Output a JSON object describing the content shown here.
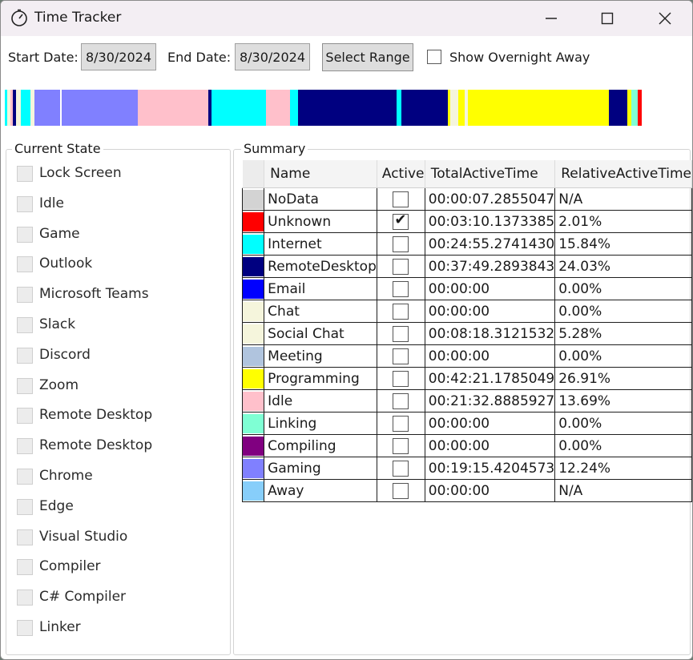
{
  "window": {
    "title": "Time Tracker",
    "icon": "stopwatch-icon"
  },
  "toolbar": {
    "start_label": "Start Date:",
    "start_value": "8/30/2024",
    "end_label": "End Date:",
    "end_value": "8/30/2024",
    "select_range": "Select Range",
    "show_overnight": "Show Overnight Away",
    "show_overnight_checked": false
  },
  "timeline": {
    "colors_note": "activity timeline strip",
    "segments": [
      {
        "color": "#00FFFF",
        "share": 0.003
      },
      {
        "color": "#F5F5DC",
        "share": 0.004
      },
      {
        "color": "#FFC0CB",
        "share": 0.003
      },
      {
        "color": "#000080",
        "share": 0.004
      },
      {
        "color": "#F5F5DC",
        "share": 0.006
      },
      {
        "color": "#00FFFF",
        "share": 0.012
      },
      {
        "color": "#F5F5DC",
        "share": 0.005
      },
      {
        "color": "#8080FF",
        "share": 0.032
      },
      {
        "color": "#FFFFFF",
        "share": 0.002
      },
      {
        "color": "#8080FF",
        "share": 0.095
      },
      {
        "color": "#FFC0CB",
        "share": 0.088
      },
      {
        "color": "#000080",
        "share": 0.004
      },
      {
        "color": "#00FFFF",
        "share": 0.068
      },
      {
        "color": "#FFC0CB",
        "share": 0.03
      },
      {
        "color": "#00FFFF",
        "share": 0.01
      },
      {
        "color": "#000080",
        "share": 0.123
      },
      {
        "color": "#00FFFF",
        "share": 0.006
      },
      {
        "color": "#000080",
        "share": 0.058
      },
      {
        "color": "#FFFF00",
        "share": 0.003
      },
      {
        "color": "#F5F5DC",
        "share": 0.01
      },
      {
        "color": "#FFFF00",
        "share": 0.008
      },
      {
        "color": "#F5F5DC",
        "share": 0.004
      },
      {
        "color": "#FFFF00",
        "share": 0.176
      },
      {
        "color": "#000080",
        "share": 0.023
      },
      {
        "color": "#FFFF00",
        "share": 0.005
      },
      {
        "color": "#7FFFD4",
        "share": 0.008
      },
      {
        "color": "#FF0000",
        "share": 0.005
      }
    ]
  },
  "current_state": {
    "legend": "Current State",
    "items": [
      "Lock Screen",
      "Idle",
      "Game",
      "Outlook",
      "Microsoft Teams",
      "Slack",
      "Discord",
      "Zoom",
      "Remote Desktop",
      "Remote Desktop",
      "Chrome",
      "Edge",
      "Visual Studio",
      "Compiler",
      "C# Compiler",
      "Linker"
    ]
  },
  "summary": {
    "legend": "Summary",
    "columns": [
      "Name",
      "Active",
      "TotalActiveTime",
      "RelativeActiveTime"
    ],
    "rows": [
      {
        "color": "#D3D3D3",
        "name": "NoData",
        "active": false,
        "total": "00:00:07.2855047",
        "relative": "N/A"
      },
      {
        "color": "#FF0000",
        "name": "Unknown",
        "active": true,
        "total": "00:03:10.1373385",
        "relative": "2.01%"
      },
      {
        "color": "#00FFFF",
        "name": "Internet",
        "active": false,
        "total": "00:24:55.2741430",
        "relative": "15.84%"
      },
      {
        "color": "#000080",
        "name": "RemoteDesktop",
        "active": false,
        "total": "00:37:49.2893843",
        "relative": "24.03%"
      },
      {
        "color": "#0000FF",
        "name": "Email",
        "active": false,
        "total": "00:00:00",
        "relative": "0.00%"
      },
      {
        "color": "#F5F5DC",
        "name": "Chat",
        "active": false,
        "total": "00:00:00",
        "relative": "0.00%"
      },
      {
        "color": "#F5F5DC",
        "name": "Social Chat",
        "active": false,
        "total": "00:08:18.3121532",
        "relative": "5.28%"
      },
      {
        "color": "#B0C4DE",
        "name": "Meeting",
        "active": false,
        "total": "00:00:00",
        "relative": "0.00%"
      },
      {
        "color": "#FFFF00",
        "name": "Programming",
        "active": false,
        "total": "00:42:21.1785049",
        "relative": "26.91%"
      },
      {
        "color": "#FFC0CB",
        "name": "Idle",
        "active": false,
        "total": "00:21:32.8885927",
        "relative": "13.69%"
      },
      {
        "color": "#7FFFD4",
        "name": "Linking",
        "active": false,
        "total": "00:00:00",
        "relative": "0.00%"
      },
      {
        "color": "#800080",
        "name": "Compiling",
        "active": false,
        "total": "00:00:00",
        "relative": "0.00%"
      },
      {
        "color": "#8080FF",
        "name": "Gaming",
        "active": false,
        "total": "00:19:15.4204573",
        "relative": "12.24%"
      },
      {
        "color": "#87CEFA",
        "name": "Away",
        "active": false,
        "total": "00:00:00",
        "relative": "N/A"
      }
    ]
  }
}
